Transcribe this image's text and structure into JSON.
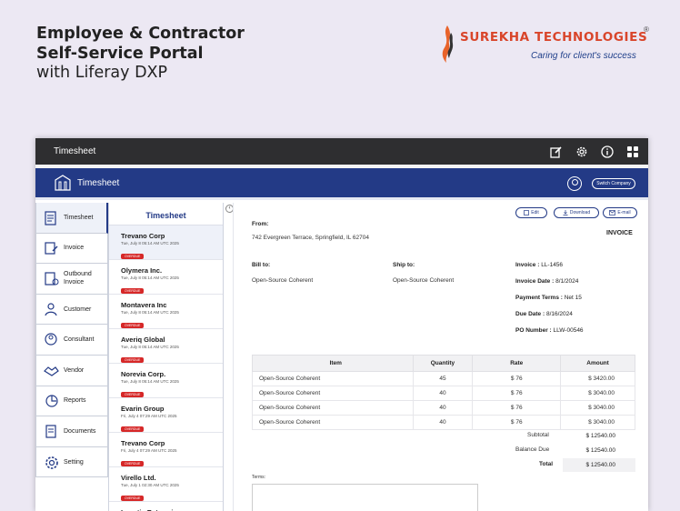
{
  "hero": {
    "line1": "Employee & Contractor",
    "line2": "Self-Service Portal",
    "line3": "with Liferay DXP"
  },
  "logo": {
    "name": "SUREKHA TECHNOLOGIES",
    "registered": "®",
    "tagline": "Caring for client's success"
  },
  "topbar": {
    "title": "Timesheet",
    "icons": [
      "edit-icon",
      "gear-icon",
      "info-icon",
      "apps-icon"
    ]
  },
  "bluebar": {
    "title": "Timesheet",
    "switch_label": "Switch Company"
  },
  "nav": {
    "items": [
      {
        "label": "Timesheet",
        "icon": "timesheet-icon"
      },
      {
        "label": "Invoice",
        "icon": "invoice-icon"
      },
      {
        "label": "Outbound Invoice",
        "icon": "outbound-invoice-icon"
      },
      {
        "label": "Customer",
        "icon": "customer-icon"
      },
      {
        "label": "Consultant",
        "icon": "consultant-icon"
      },
      {
        "label": "Vendor",
        "icon": "vendor-icon"
      },
      {
        "label": "Reports",
        "icon": "reports-icon"
      },
      {
        "label": "Documents",
        "icon": "documents-icon"
      },
      {
        "label": "Setting",
        "icon": "settings-icon"
      }
    ]
  },
  "list": {
    "title": "Timesheet",
    "collapse": "‹",
    "items": [
      {
        "name": "Trevano Corp",
        "date": "Tue, July 8 05:14 AM UTC 2025",
        "badge": "OVERDUE"
      },
      {
        "name": "Olymera Inc.",
        "date": "Tue, July 8 05:14 AM UTC 2025",
        "badge": "OVERDUE"
      },
      {
        "name": "Montavera Inc",
        "date": "Tue, July 8 05:14 AM UTC 2025",
        "badge": "OVERDUE"
      },
      {
        "name": "Averiq Global",
        "date": "Tue, July 8 05:14 AM UTC 2025",
        "badge": "OVERDUE"
      },
      {
        "name": "Norevia Corp.",
        "date": "Tue, July 8 05:14 AM UTC 2025",
        "badge": "OVERDUE"
      },
      {
        "name": "Evarin Group",
        "date": "Fri, July 4 07:29 AM UTC 2025",
        "badge": "OVERDUE"
      },
      {
        "name": "Trevano Corp",
        "date": "Fri, July 4 07:29 AM UTC 2025",
        "badge": "OVERDUE"
      },
      {
        "name": "Virello Ltd.",
        "date": "Tue, July 1 02:30 AM UTC 2025",
        "badge": "OVERDUE"
      },
      {
        "name": "Lunatix Enterprises",
        "date": "",
        "badge": ""
      }
    ]
  },
  "invoice": {
    "buttons": {
      "edit": "Edit",
      "download": "Download",
      "email": "E-mail"
    },
    "heading": "INVOICE",
    "from_label": "From:",
    "from_address": "742 Evergreen Terrace, Springfield, IL 62704",
    "bill_label": "Bill to:",
    "bill_value": "Open-Source Coherent",
    "ship_label": "Ship to:",
    "ship_value": "Open-Source Coherent",
    "details": [
      {
        "label": "Invoice :",
        "value": "LL-1456"
      },
      {
        "label": "Invoice Date :",
        "value": "8/1/2024"
      },
      {
        "label": "Payment Terms :",
        "value": "Net 15"
      },
      {
        "label": "Due Date :",
        "value": "8/16/2024"
      },
      {
        "label": "PO Number :",
        "value": "LLW-00546"
      }
    ],
    "table": {
      "headers": [
        "Item",
        "Quantity",
        "Rate",
        "Amount"
      ],
      "rows": [
        [
          "Open-Source Coherent",
          "45",
          "$ 76",
          "$ 3420.00"
        ],
        [
          "Open-Source Coherent",
          "40",
          "$ 76",
          "$ 3040.00"
        ],
        [
          "Open-Source Coherent",
          "40",
          "$ 76",
          "$ 3040.00"
        ],
        [
          "Open-Source Coherent",
          "40",
          "$ 76",
          "$ 3040.00"
        ]
      ]
    },
    "subtotal_label": "Subtotal",
    "subtotal_value": "$ 12540.00",
    "balance_label": "Balance Due",
    "balance_value": "$ 12540.00",
    "total_label": "Total",
    "total_value": "$ 12540.00",
    "terms_label": "Terms:"
  },
  "colors": {
    "brand_blue": "#233a86",
    "topbar": "#2e2e30",
    "overdue": "#d62828",
    "logo_orange": "#d9452a"
  }
}
